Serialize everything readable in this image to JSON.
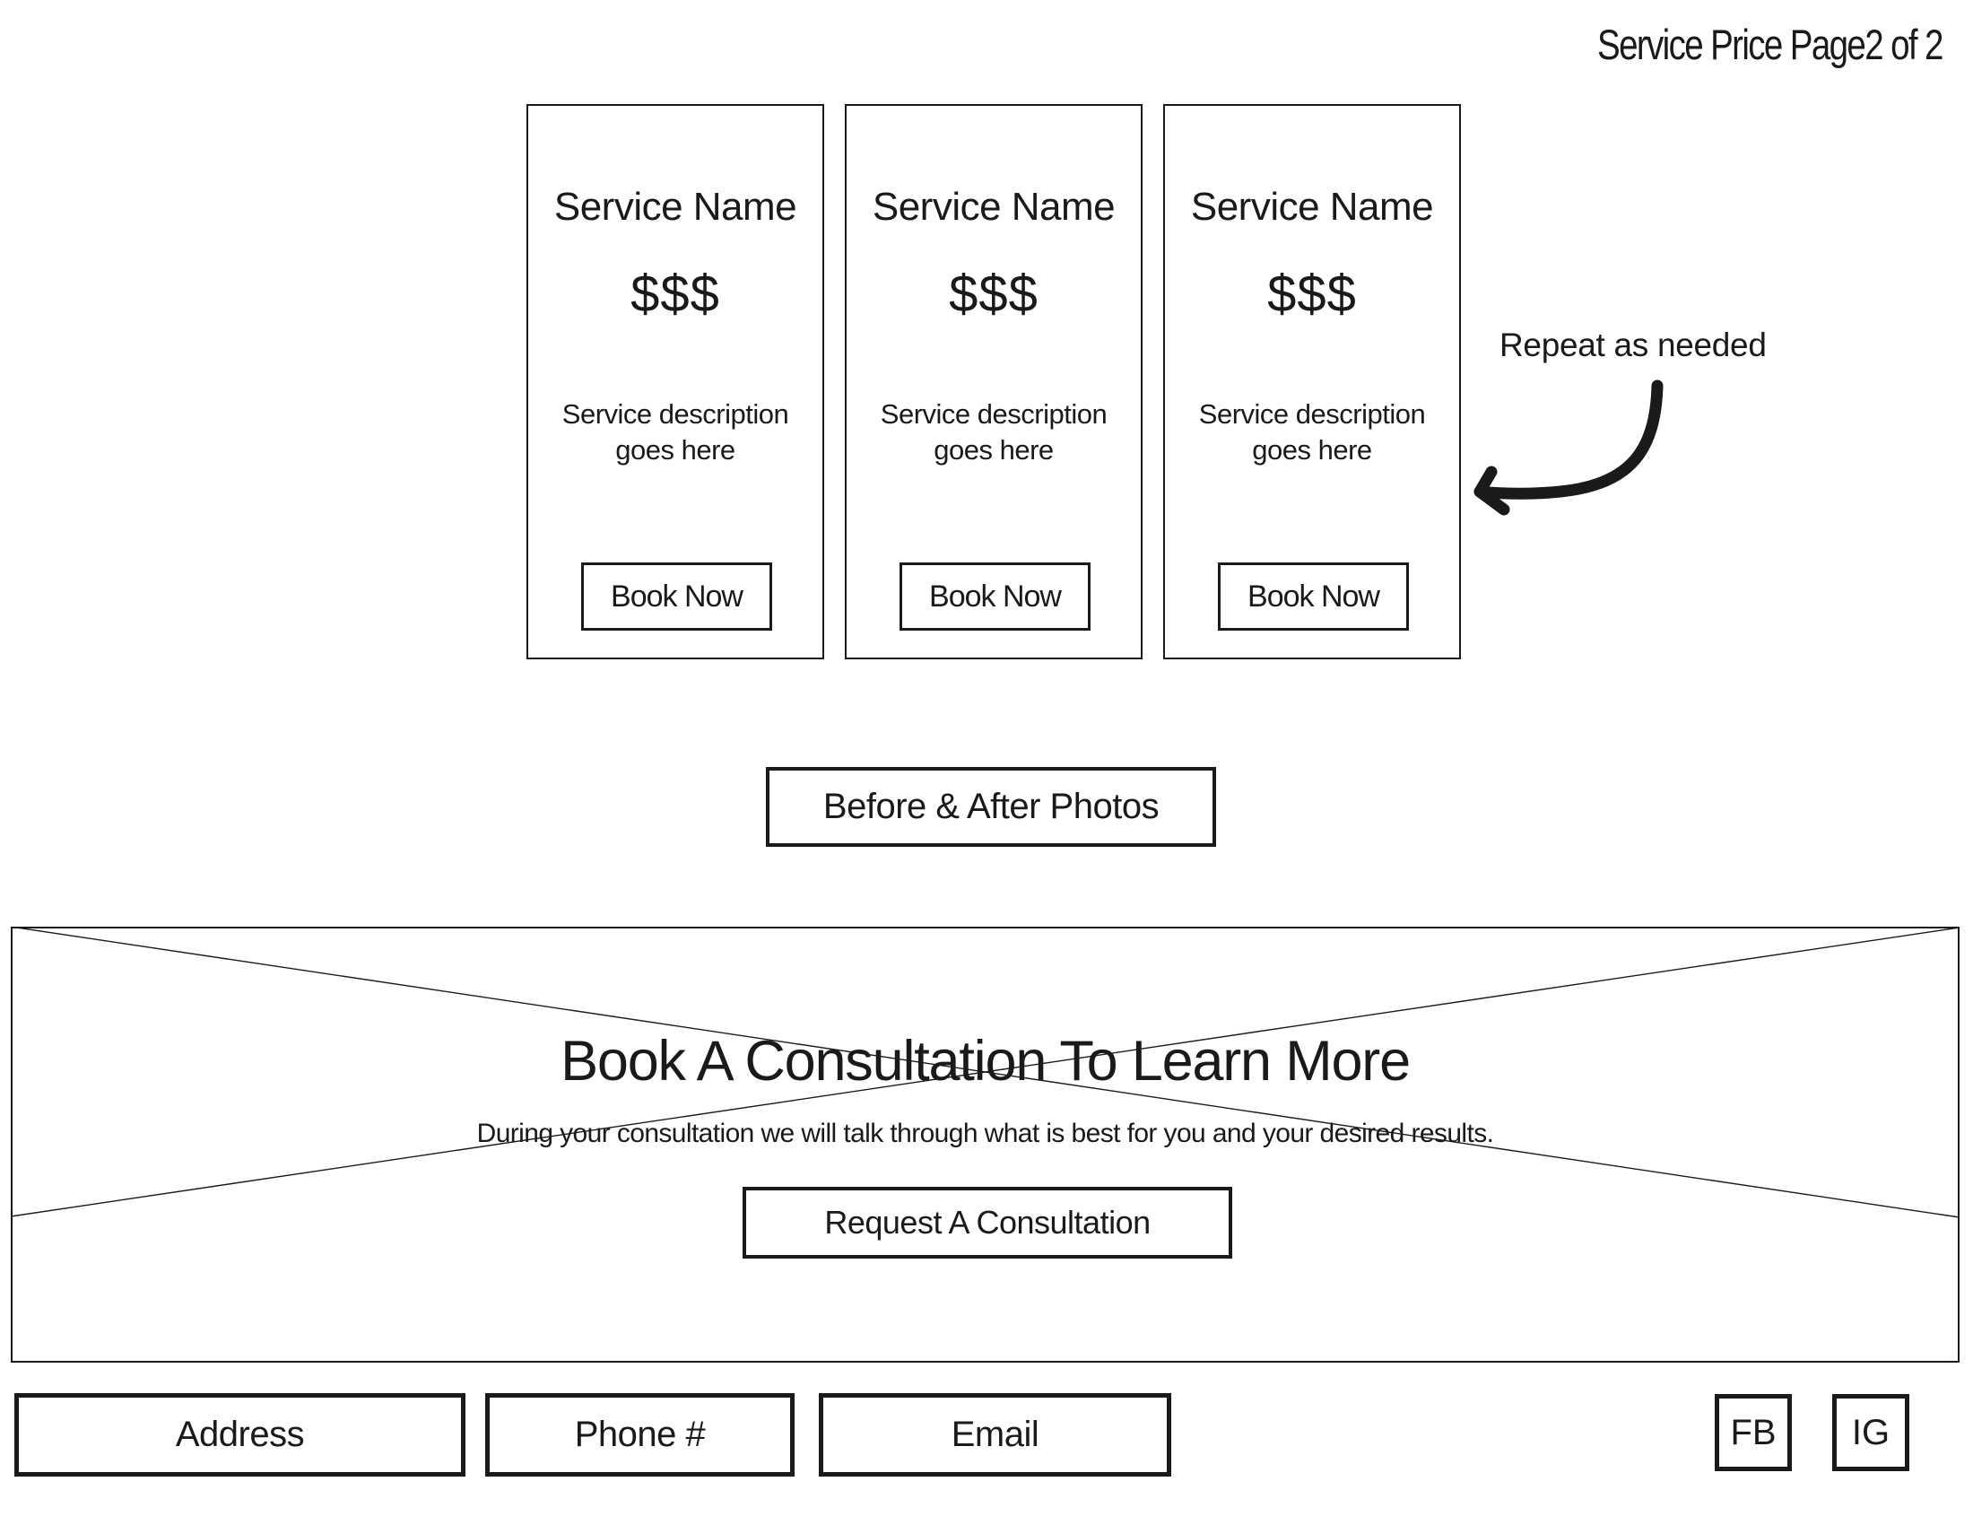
{
  "header": {
    "page_title": "Service Price Page2 of 2"
  },
  "services": [
    {
      "name": "Service Name",
      "price": "$$$",
      "description": "Service description goes here",
      "button_label": "Book Now"
    },
    {
      "name": "Service Name",
      "price": "$$$",
      "description": "Service description goes here",
      "button_label": "Book Now"
    },
    {
      "name": "Service Name",
      "price": "$$$",
      "description": "Service description goes here",
      "button_label": "Book Now"
    }
  ],
  "annotation": {
    "text": "Repeat as needed",
    "icon": "curved-arrow-left-icon"
  },
  "gallery": {
    "button_label": "Before & After Photos"
  },
  "hero": {
    "image_placeholder": "image-placeholder-icon",
    "title": "Book A Consultation To Learn More",
    "subtitle": "During your consultation we will talk through what is best for you and your desired results.",
    "button_label": "Request A Consultation"
  },
  "footer": {
    "address_label": "Address",
    "phone_label": "Phone #",
    "email_label": "Email",
    "social": [
      {
        "label": "FB"
      },
      {
        "label": "IG"
      }
    ]
  },
  "colors": {
    "ink": "#1a1a1a",
    "background": "#ffffff"
  }
}
